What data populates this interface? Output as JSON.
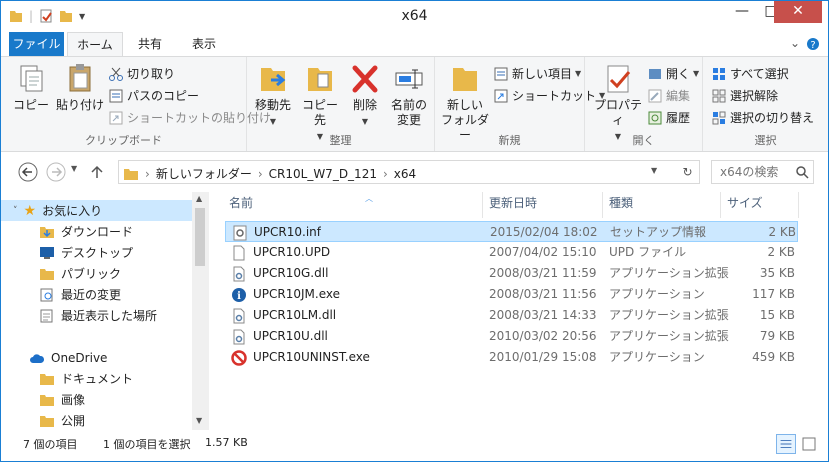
{
  "window": {
    "title": "x64",
    "minimize": "—",
    "maximize": "□",
    "close": "✕"
  },
  "tabs": {
    "file": "ファイル",
    "home": "ホーム",
    "share": "共有",
    "view": "表示"
  },
  "ribbon": {
    "clipboard": {
      "label": "クリップボード",
      "copy": "コピー",
      "paste": "貼り付け",
      "cut": "切り取り",
      "copy_path": "パスのコピー",
      "paste_shortcut": "ショートカットの貼り付け"
    },
    "organize": {
      "label": "整理",
      "move_to": "移動先",
      "copy_to": "コピー先",
      "delete": "削除",
      "rename_line1": "名前の",
      "rename_line2": "変更"
    },
    "new": {
      "label": "新規",
      "new_folder_line1": "新しい",
      "new_folder_line2": "フォルダー",
      "new_item": "新しい項目",
      "shortcut": "ショートカット"
    },
    "open": {
      "label": "開く",
      "properties": "プロパティ",
      "open": "開く",
      "edit": "編集",
      "history": "履歴"
    },
    "select": {
      "label": "選択",
      "select_all": "すべて選択",
      "select_none": "選択解除",
      "invert": "選択の切り替え"
    }
  },
  "address": {
    "crumbs": [
      "新しいフォルダー",
      "CR10L_W7_D_121",
      "x64"
    ],
    "search_placeholder": "x64の検索",
    "refresh": "↻"
  },
  "nav": {
    "favorites": "お気に入り",
    "fav_items": [
      "ダウンロード",
      "デスクトップ",
      "パブリック",
      "最近の変更",
      "最近表示した場所"
    ],
    "onedrive": "OneDrive",
    "od_items": [
      "ドキュメント",
      "画像",
      "公開"
    ]
  },
  "columns": {
    "name": "名前",
    "date": "更新日時",
    "type": "種類",
    "size": "サイズ"
  },
  "files": [
    {
      "name": "UPCR10.inf",
      "date": "2015/02/04 18:02",
      "type": "セットアップ情報",
      "size": "2 KB",
      "icon": "setup-info-icon"
    },
    {
      "name": "UPCR10.UPD",
      "date": "2007/04/02 15:10",
      "type": "UPD ファイル",
      "size": "2 KB",
      "icon": "blank-file-icon"
    },
    {
      "name": "UPCR10G.dll",
      "date": "2008/03/21 11:59",
      "type": "アプリケーション拡張",
      "size": "35 KB",
      "icon": "dll-icon"
    },
    {
      "name": "UPCR10JM.exe",
      "date": "2008/03/21 11:56",
      "type": "アプリケーション",
      "size": "117 KB",
      "icon": "info-exe-icon"
    },
    {
      "name": "UPCR10LM.dll",
      "date": "2008/03/21 14:33",
      "type": "アプリケーション拡張",
      "size": "15 KB",
      "icon": "dll-icon"
    },
    {
      "name": "UPCR10U.dll",
      "date": "2010/03/02 20:56",
      "type": "アプリケーション拡張",
      "size": "79 KB",
      "icon": "dll-icon"
    },
    {
      "name": "UPCR10UNINST.exe",
      "date": "2010/01/29 15:08",
      "type": "アプリケーション",
      "size": "459 KB",
      "icon": "uninstall-exe-icon"
    }
  ],
  "status": {
    "count": "7 個の項目",
    "selected": "1 個の項目を選択",
    "size": "1.57 KB"
  },
  "colors": {
    "accent": "#1979ca",
    "selection": "#cce8ff",
    "close": "#c7504b"
  }
}
